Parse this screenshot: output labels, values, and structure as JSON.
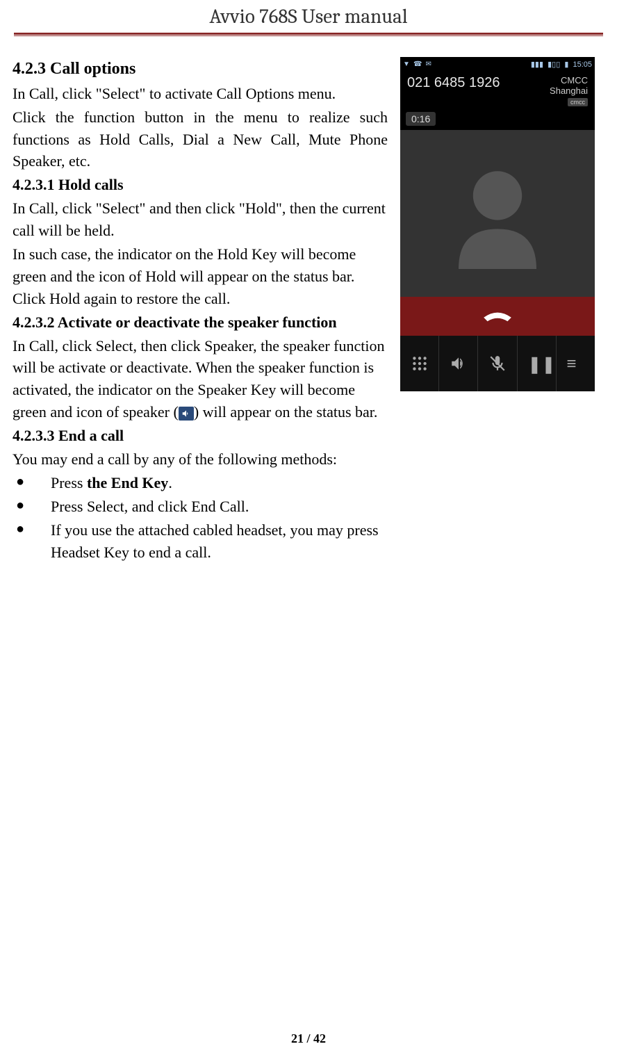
{
  "header": {
    "title_bold": "Avvio 768S",
    "title_rest": " User manual"
  },
  "section": {
    "h423": "4.2.3 Call options",
    "p1": "In Call, click \"Select\" to activate Call Options menu.",
    "p2": "Click the function button in the menu to realize such functions as Hold Calls, Dial a New Call, Mute Phone Speaker, etc.",
    "h4231": "4.2.3.1 Hold calls",
    "p3": "In Call, click \"Select\" and then click \"Hold\", then the current call will be held.",
    "p4": "In such case, the indicator on the Hold Key will become green and the icon of Hold will appear on the status bar. Click Hold again to restore the call.",
    "h4232": "4.2.3.2 Activate or deactivate the speaker function",
    "p5a": "In Call, click Select, then click Speaker, the speaker function will be activate or deactivate. When the speaker function is activated, the indicator on the Speaker Key will become green and icon of speaker (",
    "p5b": ") will appear on the status bar.",
    "h4233": "4.2.3.3 End a call",
    "p6": "You may end a call by any of the following methods:",
    "bullets": {
      "b1a": "Press ",
      "b1b_bold": "the End Key",
      "b1c": ".",
      "b2": "Press Select, and click End Call.",
      "b3": "If you use the attached cabled headset, you may press Headset Key to end a call."
    }
  },
  "phone": {
    "time": "15:05",
    "number": "021 6485 1926",
    "operator": "CMCC",
    "location": "Shanghai",
    "sim_label": "cmcc",
    "duration": "0:16"
  },
  "footer": {
    "page": "21 / 42"
  }
}
